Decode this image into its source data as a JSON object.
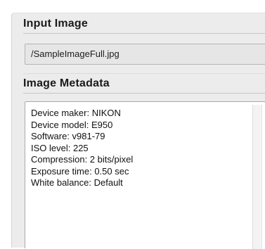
{
  "input_section": {
    "title": "Input Image",
    "path_value": "/SampleImageFull.jpg"
  },
  "metadata_section": {
    "title": "Image Metadata",
    "lines": [
      "Device maker: NIKON",
      "Device model: E950",
      "Software: v981-79",
      "ISO level: 225",
      "Compression: 2 bits/pixel",
      "Exposure time: 0.50 sec",
      "White balance: Default"
    ]
  }
}
